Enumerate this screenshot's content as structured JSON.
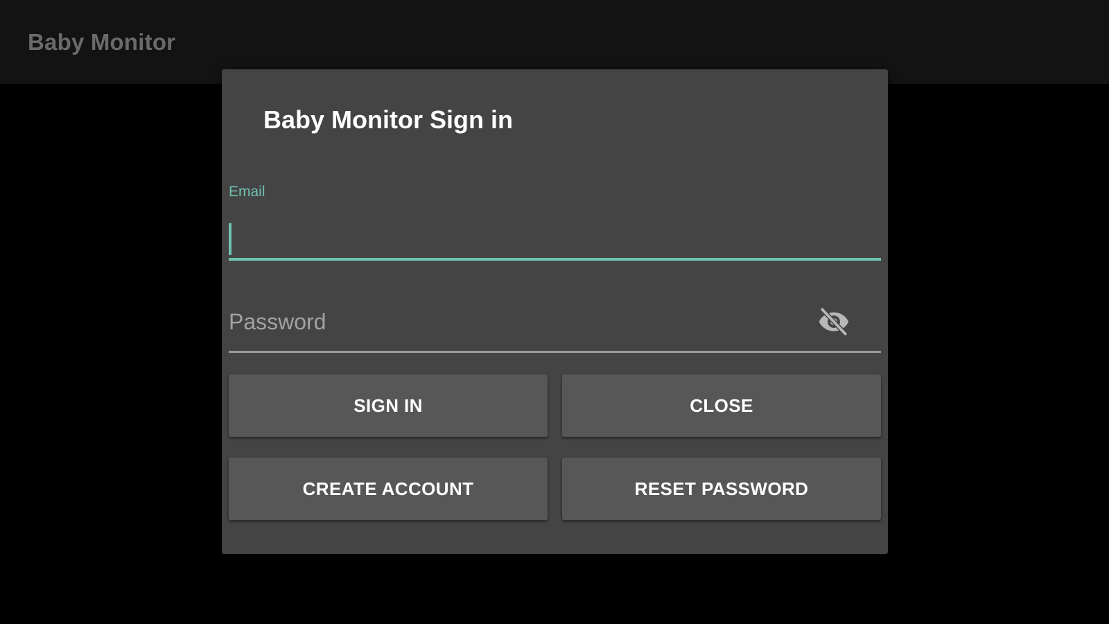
{
  "app_bar": {
    "title": "Baby Monitor"
  },
  "dialog": {
    "title": "Baby Monitor Sign in",
    "email": {
      "label": "Email",
      "value": ""
    },
    "password": {
      "placeholder": "Password",
      "value": "",
      "toggle_icon": "eye-off-icon"
    },
    "buttons": {
      "sign_in": "SIGN IN",
      "close": "CLOSE",
      "create_account": "CREATE ACCOUNT",
      "reset_password": "RESET PASSWORD"
    }
  },
  "colors": {
    "accent": "#6fc1b0",
    "dialog_background": "#444444",
    "button_background": "#575757",
    "screen_background": "#000000",
    "app_bar_background": "#131313"
  }
}
